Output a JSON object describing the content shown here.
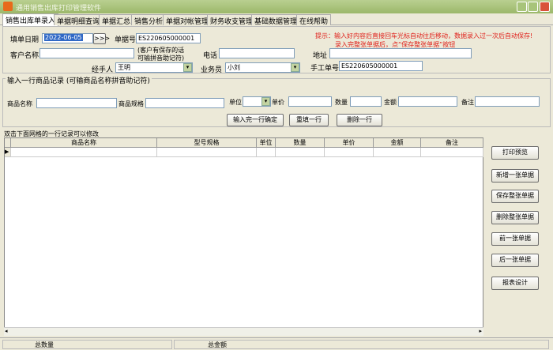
{
  "window": {
    "title": "通用销售出库打印管理软件"
  },
  "tabs": [
    "销售出库单录入",
    "单据明细查询",
    "单据汇总",
    "销售分析",
    "单据对帐管理",
    "财务收支管理",
    "基础数据管理",
    "在线帮助"
  ],
  "header": {
    "date_label": "填单日期",
    "date_value": "2022-06-05",
    "date_btn": ">>>",
    "bill_no_label": "单据号",
    "bill_no_value": "ES220605000001",
    "customer_label": "客户名称",
    "customer_value": "",
    "customer_hint1": "(客户有保存的话",
    "customer_hint2": "可输拼音助记符)",
    "phone_label": "电话",
    "phone_value": "",
    "address_label": "地址",
    "address_value": "",
    "handler_label": "经手人",
    "handler_value": "王明",
    "sales_label": "业务员",
    "sales_value": "小刘",
    "manual_no_label": "手工单号",
    "manual_no_value": "ES220605000001",
    "hint1": "提示：输入好内容后直接回车光标自动往后移动，数据录入过一次后自动保存!",
    "hint2": "录入完整张单据后，点“保存整张单据”按钮"
  },
  "entry": {
    "group_label": "输入一行商品记录 (可输商品名称拼音助记符)",
    "name_label": "商品名称",
    "spec_label": "商品规格",
    "unit_label": "单位",
    "price_label": "单价",
    "qty_label": "数量",
    "amount_label": "金额",
    "remark_label": "备注",
    "confirm_btn": "输入完一行确定",
    "refill_btn": "重填一行",
    "delete_btn": "删除一行"
  },
  "grid": {
    "caption": "双击下面网格的一行记录可以修改",
    "columns": [
      "商品名称",
      "型号规格",
      "单位",
      "数量",
      "单价",
      "金额",
      "备注"
    ]
  },
  "actions": [
    "打印预览",
    "新增一张单据",
    "保存整张单据",
    "删除整张单据",
    "前一张单据",
    "后一张单据",
    "报表设计"
  ],
  "status": {
    "total_qty_label": "总数量",
    "total_amount_label": "总金额"
  },
  "colors": {
    "title_bar": "#9cb86a",
    "hint": "#e0201a"
  }
}
